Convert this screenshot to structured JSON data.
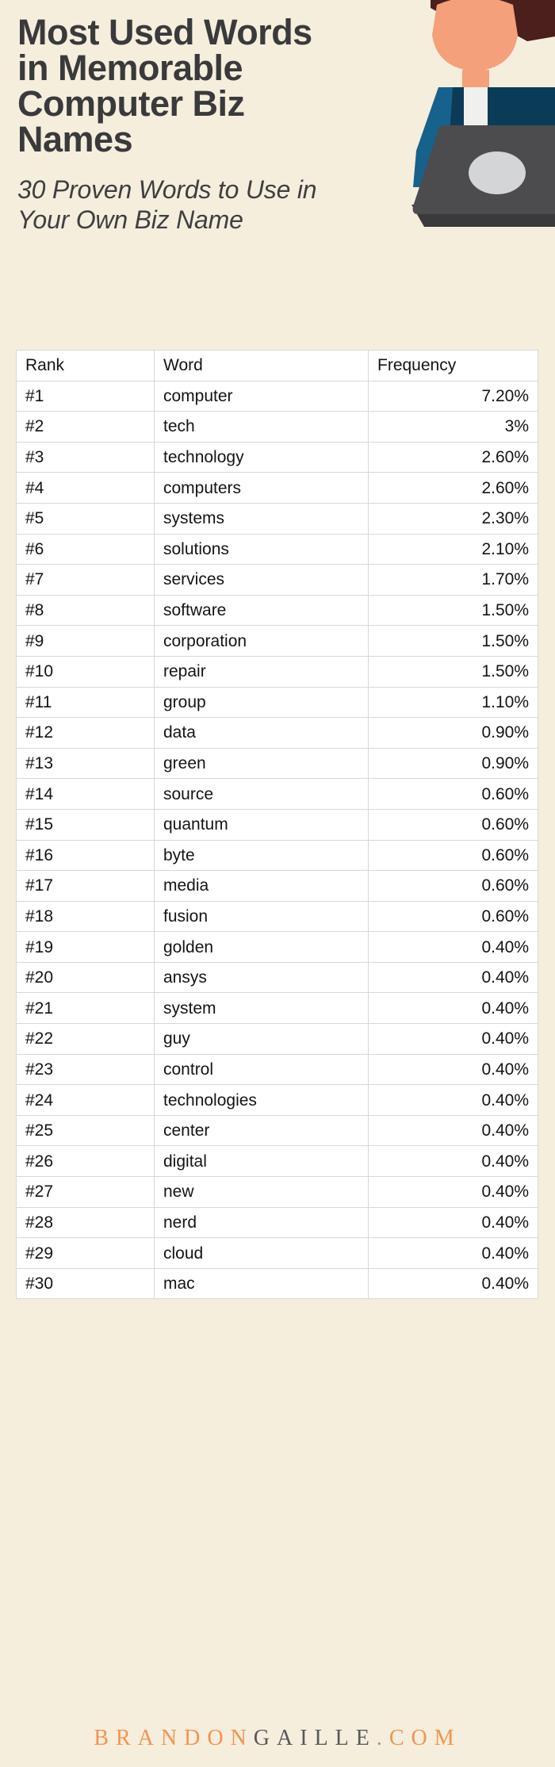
{
  "header": {
    "title": "Most Used Words\nin Memorable\nComputer Biz\nNames",
    "subtitle": "30 Proven Words to Use in\nYour Own Biz Name"
  },
  "illustration": {
    "name": "businessman-at-laptop-illustration",
    "colors": {
      "hair": "#4a1f1c",
      "skin": "#f4a07a",
      "suit": "#0b3c57",
      "arm": "#17628c",
      "shirt": "#f0f0ee",
      "laptop": "#4c4b4d",
      "laptop_shadow": "#3a393b",
      "laptop_logo": "#d4d5d7"
    }
  },
  "table": {
    "columns": [
      "Rank",
      "Word",
      "Frequency"
    ],
    "rows": [
      {
        "rank": "#1",
        "word": "computer",
        "frequency": "7.20%"
      },
      {
        "rank": "#2",
        "word": "tech",
        "frequency": "3%"
      },
      {
        "rank": "#3",
        "word": "technology",
        "frequency": "2.60%"
      },
      {
        "rank": "#4",
        "word": "computers",
        "frequency": "2.60%"
      },
      {
        "rank": "#5",
        "word": "systems",
        "frequency": "2.30%"
      },
      {
        "rank": "#6",
        "word": "solutions",
        "frequency": "2.10%"
      },
      {
        "rank": "#7",
        "word": "services",
        "frequency": "1.70%"
      },
      {
        "rank": "#8",
        "word": "software",
        "frequency": "1.50%"
      },
      {
        "rank": "#9",
        "word": "corporation",
        "frequency": "1.50%"
      },
      {
        "rank": "#10",
        "word": "repair",
        "frequency": "1.50%"
      },
      {
        "rank": "#11",
        "word": "group",
        "frequency": "1.10%"
      },
      {
        "rank": "#12",
        "word": "data",
        "frequency": "0.90%"
      },
      {
        "rank": "#13",
        "word": "green",
        "frequency": "0.90%"
      },
      {
        "rank": "#14",
        "word": "source",
        "frequency": "0.60%"
      },
      {
        "rank": "#15",
        "word": "quantum",
        "frequency": "0.60%"
      },
      {
        "rank": "#16",
        "word": "byte",
        "frequency": "0.60%"
      },
      {
        "rank": "#17",
        "word": "media",
        "frequency": "0.60%"
      },
      {
        "rank": "#18",
        "word": "fusion",
        "frequency": "0.60%"
      },
      {
        "rank": "#19",
        "word": "golden",
        "frequency": "0.40%"
      },
      {
        "rank": "#20",
        "word": "ansys",
        "frequency": "0.40%"
      },
      {
        "rank": "#21",
        "word": "system",
        "frequency": "0.40%"
      },
      {
        "rank": "#22",
        "word": "guy",
        "frequency": "0.40%"
      },
      {
        "rank": "#23",
        "word": "control",
        "frequency": "0.40%"
      },
      {
        "rank": "#24",
        "word": "technologies",
        "frequency": "0.40%"
      },
      {
        "rank": "#25",
        "word": "center",
        "frequency": "0.40%"
      },
      {
        "rank": "#26",
        "word": "digital",
        "frequency": "0.40%"
      },
      {
        "rank": "#27",
        "word": "new",
        "frequency": "0.40%"
      },
      {
        "rank": "#28",
        "word": "nerd",
        "frequency": "0.40%"
      },
      {
        "rank": "#29",
        "word": "cloud",
        "frequency": "0.40%"
      },
      {
        "rank": "#30",
        "word": "mac",
        "frequency": "0.40%"
      }
    ]
  },
  "footer": {
    "part1": "BRANDON",
    "part2": "GAILLE",
    "part3": ".",
    "part4": "COM",
    "accent_color": "#f5934f",
    "dark_color": "#58585a"
  },
  "chart_data": {
    "type": "table",
    "title": "Most Used Words in Memorable Computer Biz Names",
    "subtitle": "30 Proven Words to Use in Your Own Biz Name",
    "columns": [
      "Rank",
      "Word",
      "Frequency"
    ],
    "categories": [
      "computer",
      "tech",
      "technology",
      "computers",
      "systems",
      "solutions",
      "services",
      "software",
      "corporation",
      "repair",
      "group",
      "data",
      "green",
      "source",
      "quantum",
      "byte",
      "media",
      "fusion",
      "golden",
      "ansys",
      "system",
      "guy",
      "control",
      "technologies",
      "center",
      "digital",
      "new",
      "nerd",
      "cloud",
      "mac"
    ],
    "values": [
      7.2,
      3,
      2.6,
      2.6,
      2.3,
      2.1,
      1.7,
      1.5,
      1.5,
      1.5,
      1.1,
      0.9,
      0.9,
      0.6,
      0.6,
      0.6,
      0.6,
      0.6,
      0.4,
      0.4,
      0.4,
      0.4,
      0.4,
      0.4,
      0.4,
      0.4,
      0.4,
      0.4,
      0.4,
      0.4
    ],
    "xlabel": "Word",
    "ylabel": "Frequency (%)",
    "ylim": [
      0,
      7.2
    ]
  }
}
